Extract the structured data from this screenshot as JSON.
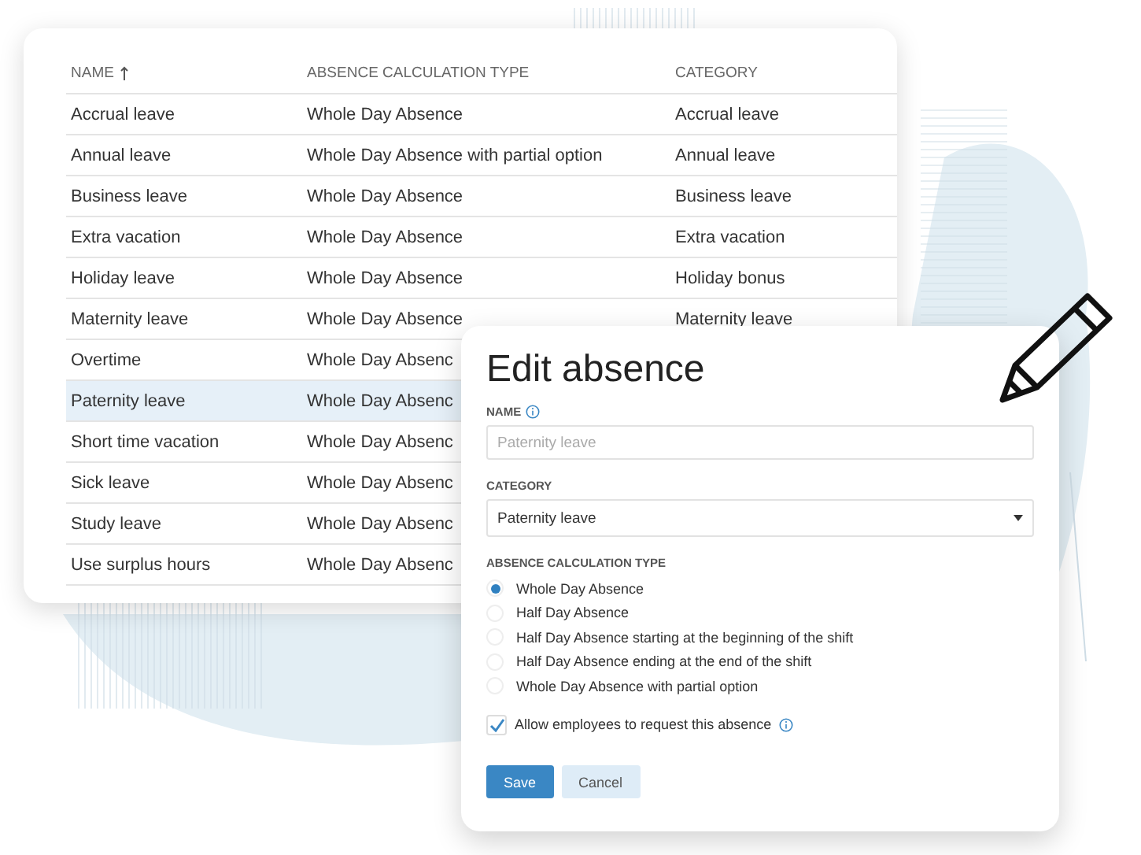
{
  "table": {
    "columns": [
      {
        "label": "NAME",
        "sorted": true
      },
      {
        "label": "ABSENCE CALCULATION TYPE",
        "sorted": false
      },
      {
        "label": "CATEGORY",
        "sorted": false
      }
    ],
    "rows": [
      {
        "name": "Accrual leave",
        "type": "Whole Day Absence",
        "category": "Accrual leave",
        "selected": false
      },
      {
        "name": "Annual leave",
        "type": "Whole Day Absence with partial option",
        "category": "Annual leave",
        "selected": false
      },
      {
        "name": "Business leave",
        "type": "Whole Day Absence",
        "category": "Business leave",
        "selected": false
      },
      {
        "name": "Extra vacation",
        "type": "Whole Day Absence",
        "category": "Extra vacation",
        "selected": false
      },
      {
        "name": "Holiday leave",
        "type": "Whole Day Absence",
        "category": "Holiday bonus",
        "selected": false
      },
      {
        "name": "Maternity leave",
        "type": "Whole Day Absence",
        "category": "Maternity leave",
        "selected": false
      },
      {
        "name": "Overtime",
        "type": "Whole Day Absenc",
        "selected": false
      },
      {
        "name": "Paternity leave",
        "type": "Whole Day Absenc",
        "selected": true
      },
      {
        "name": "Short time vacation",
        "type": "Whole Day Absenc",
        "selected": false
      },
      {
        "name": "Sick leave",
        "type": "Whole Day Absenc",
        "selected": false
      },
      {
        "name": "Study leave",
        "type": "Whole Day Absenc",
        "selected": false
      },
      {
        "name": "Use surplus hours",
        "type": "Whole Day Absenc",
        "selected": false
      }
    ]
  },
  "dialog": {
    "title": "Edit absence",
    "name_field": {
      "label": "NAME",
      "placeholder": "Paternity leave"
    },
    "category_field": {
      "label": "CATEGORY",
      "value": "Paternity leave"
    },
    "calculation_type": {
      "label": "ABSENCE CALCULATION TYPE",
      "options": [
        {
          "label": "Whole Day Absence",
          "selected": true
        },
        {
          "label": "Half Day Absence",
          "selected": false
        },
        {
          "label": "Half Day Absence starting at the beginning of the shift",
          "selected": false
        },
        {
          "label": "Half Day Absence ending at the end of the shift",
          "selected": false
        },
        {
          "label": "Whole Day Absence with partial option",
          "selected": false
        }
      ]
    },
    "allow_request": {
      "label": "Allow employees to request this absence",
      "checked": true
    },
    "buttons": [
      {
        "label": "Save",
        "kind": "primary"
      },
      {
        "label": "Cancel",
        "kind": "secondary"
      }
    ]
  }
}
